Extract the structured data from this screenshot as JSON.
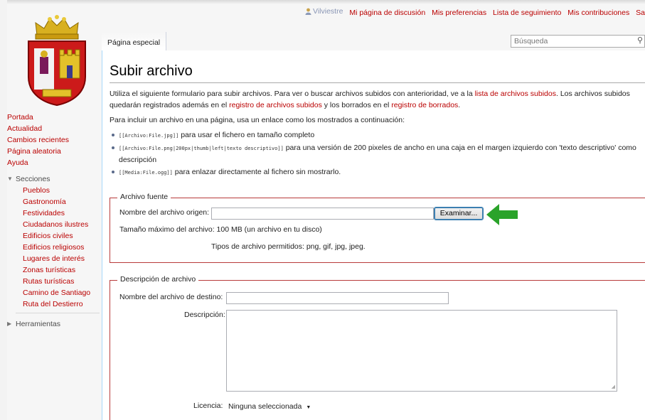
{
  "colors": {
    "link": "#ba0000",
    "accent_border": "#b83b3b",
    "arrow": "#2aa32a",
    "tab_border": "#a7d7f9"
  },
  "personal": {
    "user": "Vilviestre",
    "links": [
      "Mi página de discusión",
      "Mis preferencias",
      "Lista de seguimiento",
      "Mis contribuciones",
      "Sa"
    ]
  },
  "tab": {
    "label": "Página especial"
  },
  "search": {
    "placeholder": "Búsqueda",
    "icon": "magnifier-icon"
  },
  "sidebar": {
    "nav": [
      "Portada",
      "Actualidad",
      "Cambios recientes",
      "Página aleatoria",
      "Ayuda"
    ],
    "sections_label": "Secciones",
    "sections": [
      "Pueblos",
      "Gastronomía",
      "Festividades",
      "Ciudadanos ilustres",
      "Edificios civiles",
      "Edificios religiosos",
      "Lugares de interés",
      "Zonas turísticas",
      "Rutas turísticas",
      "Camino de Santiago",
      "Ruta del Destierro"
    ],
    "tools_label": "Herramientas"
  },
  "page": {
    "title": "Subir archivo",
    "intro_1": "Utiliza el siguiente formulario para subir archivos. Para ver o buscar archivos subidos con anterioridad, ve a la ",
    "intro_link_1": "lista de archivos subidos",
    "intro_2": ". Los archivos subidos quedarán registrados además en el ",
    "intro_link_2": "registro de archivos subidos",
    "intro_3": " y los borrados en el ",
    "intro_link_3": "registro de borrados",
    "intro_4": ".",
    "include_text": "Para incluir un archivo en una página, usa un enlace como los mostrados a continuación:",
    "bullets": [
      {
        "code": "[[Archivo:File.jpg]]",
        "text": " para usar el fichero en tamaño completo"
      },
      {
        "code": "[[Archivo:File.png|200px|thumb|left|texto descriptivo]]",
        "text": " para una versión de 200 pixeles de ancho en una caja en el margen izquierdo con 'texto descriptivo' como descripción"
      },
      {
        "code": "[[Media:File.ogg]]",
        "text": " para enlazar directamente al fichero sin mostrarlo."
      }
    ]
  },
  "source": {
    "legend": "Archivo fuente",
    "file_label": "Nombre del archivo origen:",
    "file_value": "",
    "browse_button": "Examinar...",
    "max_size": "Tamaño máximo del archivo: 100 MB (un archivo en tu disco)",
    "allowed_types": "Tipos de archivo permitidos: png, gif, jpg, jpeg."
  },
  "description": {
    "legend": "Descripción de archivo",
    "dest_label": "Nombre del archivo de destino:",
    "dest_value": "",
    "desc_label": "Descripción:",
    "desc_value": "",
    "license_label": "Licencia:",
    "license_value": "Ninguna seleccionada"
  }
}
